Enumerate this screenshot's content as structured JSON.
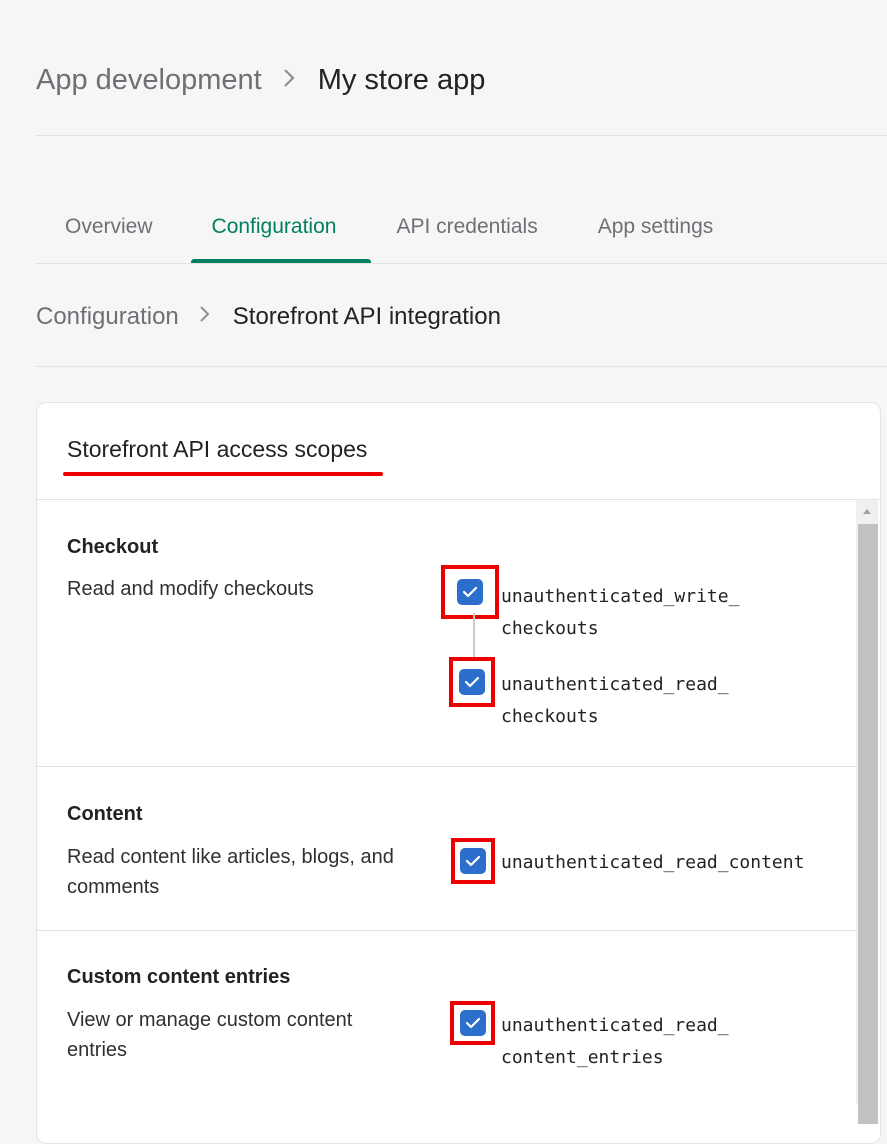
{
  "breadcrumb": {
    "parent": "App development",
    "current": "My store app"
  },
  "tabs": [
    {
      "label": "Overview",
      "active": false
    },
    {
      "label": "Configuration",
      "active": true
    },
    {
      "label": "API credentials",
      "active": false
    },
    {
      "label": "App settings",
      "active": false
    }
  ],
  "sub_breadcrumb": {
    "parent": "Configuration",
    "current": "Storefront API integration"
  },
  "card": {
    "title": "Storefront API access scopes",
    "sections": [
      {
        "title": "Checkout",
        "description": "Read and modify checkouts",
        "scopes": [
          {
            "label": "unauthenticated_write_\ncheckouts",
            "checked": true
          },
          {
            "label": "unauthenticated_read_\ncheckouts",
            "checked": true
          }
        ]
      },
      {
        "title": "Content",
        "description": "Read content like articles, blogs, and comments",
        "scopes": [
          {
            "label": "unauthenticated_read_content",
            "checked": true
          }
        ]
      },
      {
        "title": "Custom content entries",
        "description": "View or manage custom content entries",
        "scopes": [
          {
            "label": "unauthenticated_read_\ncontent_entries",
            "checked": true
          }
        ]
      }
    ]
  },
  "colors": {
    "accent": "#008060",
    "checkbox": "#2c6ecb",
    "highlight": "#ee0000"
  }
}
